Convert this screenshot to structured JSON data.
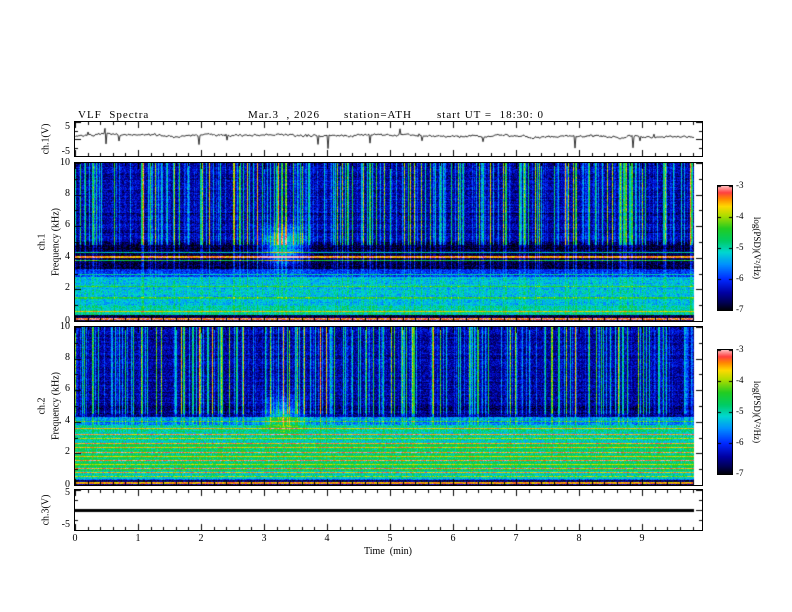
{
  "header": {
    "title": "VLF  Spectra",
    "date": "Mar.3  , 2026",
    "station": "station=ATH",
    "start_ut": "start UT =  18:30: 0"
  },
  "axes": {
    "time_label": "Time  (min)",
    "time_ticks": [
      "0",
      "1",
      "2",
      "3",
      "4",
      "5",
      "6",
      "7",
      "8",
      "9"
    ],
    "freq_ticks": [
      "10",
      "8",
      "6",
      "4",
      "2",
      "0"
    ],
    "volt_ticks": [
      "5",
      "-5"
    ],
    "colorbar_ticks": [
      "-3",
      "-4",
      "-5",
      "-6",
      "-7"
    ],
    "colorbar_label": "log(PSD)(V²/Hz)"
  },
  "panels": {
    "p1": {
      "ylabel": "ch.1(V)"
    },
    "p2": {
      "ch": "ch.1",
      "freq_label": "Frequency (kHz)"
    },
    "p3": {
      "ch": "ch.2",
      "freq_label": "Frequency (kHz)"
    },
    "p4": {
      "ylabel": "ch.3(V)"
    }
  },
  "chart_data": [
    {
      "type": "line",
      "title": "ch.1(V) voltage waveform",
      "xlabel": "Time (min)",
      "ylabel": "ch.1(V)",
      "xlim": [
        0,
        9.95
      ],
      "ylim": [
        -5,
        5
      ],
      "x_ticks": [
        0,
        1,
        2,
        3,
        4,
        5,
        6,
        7,
        8,
        9
      ],
      "y_ticks": [
        5,
        -5
      ],
      "series_note": "Continuous noisy trace centred near +1 V with frequent impulsive negative spikes reaching about -4 V; record length ~9.83 min"
    },
    {
      "type": "heatmap",
      "title": "ch.1 VLF spectrogram",
      "xlabel": "Time (min)",
      "ylabel": "Frequency (kHz)",
      "xlim": [
        0,
        9.95
      ],
      "ylim": [
        0,
        10
      ],
      "x_ticks": [
        0,
        1,
        2,
        3,
        4,
        5,
        6,
        7,
        8,
        9
      ],
      "y_ticks": [
        0,
        2,
        4,
        6,
        8,
        10
      ],
      "colorbar": {
        "label": "log(PSD)(V²/Hz)",
        "range": [
          -7,
          -3
        ],
        "ticks": [
          -3,
          -4,
          -5,
          -6,
          -7
        ]
      },
      "features": [
        "dense vertical sferic streaks (green/yellow on dark blue) above ~5 kHz",
        "very dark band 3.3-5 kHz with bright orange narrow line near 4 kHz",
        "cyan/turquoise band 0.4-3.3 kHz",
        "dark strip below 0.3 kHz with red line near 0.15 kHz",
        "transient cyan enhancement near t~3.3 min, 4-5.5 kHz"
      ]
    },
    {
      "type": "heatmap",
      "title": "ch.2 VLF spectrogram",
      "xlabel": "Time (min)",
      "ylabel": "Frequency (kHz)",
      "xlim": [
        0,
        9.95
      ],
      "ylim": [
        0,
        10
      ],
      "x_ticks": [
        0,
        1,
        2,
        3,
        4,
        5,
        6,
        7,
        8,
        9
      ],
      "y_ticks": [
        0,
        2,
        4,
        6,
        8,
        10
      ],
      "colorbar": {
        "label": "log(PSD)(V²/Hz)",
        "range": [
          -7,
          -3
        ],
        "ticks": [
          -3,
          -4,
          -5,
          -6,
          -7
        ]
      },
      "features": [
        "vertical sferic streaks above ~4.5 kHz on dark blue background",
        "broad green band 0.5-4 kHz crossed by many thin orange/red horizontal harmonic lines",
        "dark strip below 0.3 kHz with red line",
        "transient enhancement near t~3.3 min around 4-5 kHz"
      ]
    },
    {
      "type": "line",
      "title": "ch.3(V) voltage waveform",
      "xlabel": "Time (min)",
      "ylabel": "ch.3(V)",
      "xlim": [
        0,
        9.95
      ],
      "ylim": [
        -5,
        5
      ],
      "x_ticks": [
        0,
        1,
        2,
        3,
        4,
        5,
        6,
        7,
        8,
        9
      ],
      "y_ticks": [
        5,
        -5
      ],
      "series_note": "Flat heavy line at 0 V for the entire record (dead channel)"
    }
  ],
  "render": {
    "vmin": -7,
    "vmax": -3,
    "time": {
      "tmax": 9.95,
      "tend": 9.83
    },
    "colormap": [
      {
        "u": 0.0,
        "c": "#000005"
      },
      {
        "u": 0.06,
        "c": "#000050"
      },
      {
        "u": 0.14,
        "c": "#0000a0"
      },
      {
        "u": 0.25,
        "c": "#0028ff"
      },
      {
        "u": 0.37,
        "c": "#0090ff"
      },
      {
        "u": 0.47,
        "c": "#00d8d0"
      },
      {
        "u": 0.56,
        "c": "#00cc66"
      },
      {
        "u": 0.66,
        "c": "#22cc22"
      },
      {
        "u": 0.76,
        "c": "#aadd00"
      },
      {
        "u": 0.84,
        "c": "#ffd900"
      },
      {
        "u": 0.9,
        "c": "#ff8800"
      },
      {
        "u": 0.95,
        "c": "#ff4040"
      },
      {
        "u": 1.0,
        "c": "#ffb6b6"
      }
    ],
    "wave1": {
      "seed": 7,
      "base": 1.0,
      "noise": 0.55,
      "spike_prob": 0.02
    },
    "flat3": {
      "value": 0,
      "thickness": 3
    },
    "spec1": {
      "seed": 101,
      "streak_density": 0.62,
      "streak_gain": 2.5,
      "row_noise": 0.3,
      "pix_noise": 0.7,
      "bands": [
        [
          5,
          10.01,
          -6.45
        ],
        [
          3.3,
          5,
          -6.85
        ],
        [
          2.8,
          3.3,
          -6.0
        ],
        [
          1.0,
          2.8,
          -5.3
        ],
        [
          0.35,
          1.0,
          -5.05
        ],
        [
          -0.1,
          0.35,
          -6.8
        ]
      ],
      "streak_profile": [
        [
          4.8,
          10.01,
          1.0
        ],
        [
          3.3,
          4.8,
          0.35
        ],
        [
          0.35,
          3.3,
          0.18
        ],
        [
          -0.1,
          0.35,
          0.05
        ]
      ],
      "lines": [
        [
          4.05,
          0.05,
          3.2
        ],
        [
          3.85,
          0.04,
          2.2
        ],
        [
          4.35,
          0.04,
          1.6
        ],
        [
          2.95,
          0.05,
          1.0
        ],
        [
          2.2,
          0.04,
          0.8
        ],
        [
          1.45,
          0.04,
          0.7
        ],
        [
          0.6,
          0.04,
          1.2
        ],
        [
          0.15,
          0.06,
          3.6
        ],
        [
          4.6,
          0.05,
          -0.4
        ],
        [
          5.6,
          0.05,
          -0.3
        ],
        [
          6.8,
          0.04,
          -0.25
        ]
      ],
      "blob": {
        "t": 3.3,
        "f": 4.7,
        "dt": 0.22,
        "df": 0.8,
        "gain": 1.6
      }
    },
    "spec2": {
      "seed": 202,
      "streak_density": 0.55,
      "streak_gain": 2.4,
      "row_noise": 0.3,
      "pix_noise": 0.7,
      "bands": [
        [
          5,
          10.01,
          -6.45
        ],
        [
          4.3,
          5,
          -6.6
        ],
        [
          3.8,
          4.3,
          -5.6
        ],
        [
          2.6,
          3.8,
          -5.0
        ],
        [
          0.9,
          2.6,
          -4.75
        ],
        [
          0.3,
          0.9,
          -5.1
        ],
        [
          -0.1,
          0.3,
          -6.8
        ]
      ],
      "streak_profile": [
        [
          4.5,
          10.01,
          1.0
        ],
        [
          3.8,
          4.5,
          0.4
        ],
        [
          0.3,
          3.8,
          0.1
        ],
        [
          -0.1,
          0.3,
          0.05
        ]
      ],
      "lines": [
        [
          3.55,
          0.035,
          1.4
        ],
        [
          3.2,
          0.035,
          1.5
        ],
        [
          2.95,
          0.03,
          1.2
        ],
        [
          2.6,
          0.03,
          1.7
        ],
        [
          2.35,
          0.028,
          1.1
        ],
        [
          2.05,
          0.028,
          1.5
        ],
        [
          1.8,
          0.03,
          1.0
        ],
        [
          1.55,
          0.028,
          1.4
        ],
        [
          1.3,
          0.028,
          1.0
        ],
        [
          1.05,
          0.028,
          1.3
        ],
        [
          0.8,
          0.03,
          1.6
        ],
        [
          0.55,
          0.03,
          1.1
        ],
        [
          0.15,
          0.06,
          3.3
        ],
        [
          4.0,
          0.035,
          0.9
        ],
        [
          0.35,
          0.04,
          -0.8
        ]
      ],
      "blob": {
        "t": 3.3,
        "f": 4.4,
        "dt": 0.2,
        "df": 0.7,
        "gain": 1.3
      }
    }
  }
}
